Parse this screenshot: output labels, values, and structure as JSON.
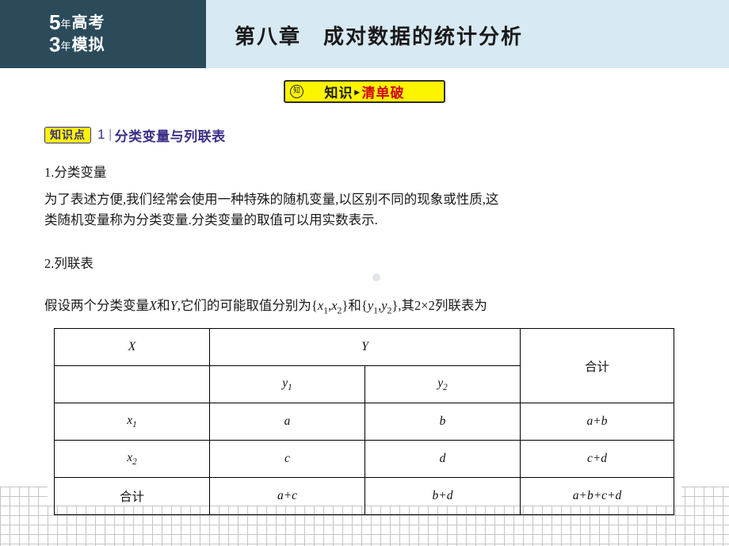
{
  "header": {
    "logo": {
      "line1_num": "5",
      "line1_cn": "年",
      "line1_big": "高考",
      "line2_num": "3",
      "line2_cn": "年",
      "line2_big": "模拟"
    },
    "chapter_title": "第八章　成对数据的统计分析"
  },
  "banner": {
    "badge": "知",
    "text_black": "知识",
    "separator": "▸",
    "text_red": "清单破"
  },
  "knowledge_point": {
    "tag": "知识点",
    "number": "1",
    "bar": "|",
    "title": "分类变量与列联表"
  },
  "content": {
    "heading1": "1.分类变量",
    "paragraph1_line1": "为了表述方便,我们经常会使用一种特殊的随机变量,以区别不同的现象或性质,这",
    "paragraph1_line2": "类随机变量称为分类变量.分类变量的取值可以用实数表示.",
    "heading2": "2.列联表",
    "paragraph2_pre": "假设两个分类变量",
    "paragraph2_var1": "X",
    "paragraph2_mid1": "和",
    "paragraph2_var2": "Y",
    "paragraph2_mid2": ",它们的可能取值分别为{",
    "paragraph2_set1a": "x",
    "paragraph2_set1a_sub": "1",
    "paragraph2_comma": ",",
    "paragraph2_set1b": "x",
    "paragraph2_set1b_sub": "2",
    "paragraph2_mid3": "}和{",
    "paragraph2_set2a": "y",
    "paragraph2_set2a_sub": "1",
    "paragraph2_set2b": "y",
    "paragraph2_set2b_sub": "2",
    "paragraph2_post": "},其2×2列联表为"
  },
  "table": {
    "header_x": "X",
    "header_y": "Y",
    "header_total": "合计",
    "sub_y1": "y",
    "sub_y1_sub": "1",
    "sub_y2": "y",
    "sub_y2_sub": "2",
    "row1_label": "x",
    "row1_label_sub": "1",
    "row1_c1": "a",
    "row1_c2": "b",
    "row1_total": "a+b",
    "row2_label": "x",
    "row2_label_sub": "2",
    "row2_c1": "c",
    "row2_c2": "d",
    "row2_total": "c+d",
    "row3_label": "合计",
    "row3_c1": "a+c",
    "row3_c2": "b+d",
    "row3_total": "a+b+c+d"
  },
  "colors": {
    "header_dark": "#2b4b5b",
    "header_light": "#d7e9f3",
    "banner_yellow": "#fdf400",
    "accent_red": "#d4001a",
    "accent_purple": "#3b2f88"
  }
}
